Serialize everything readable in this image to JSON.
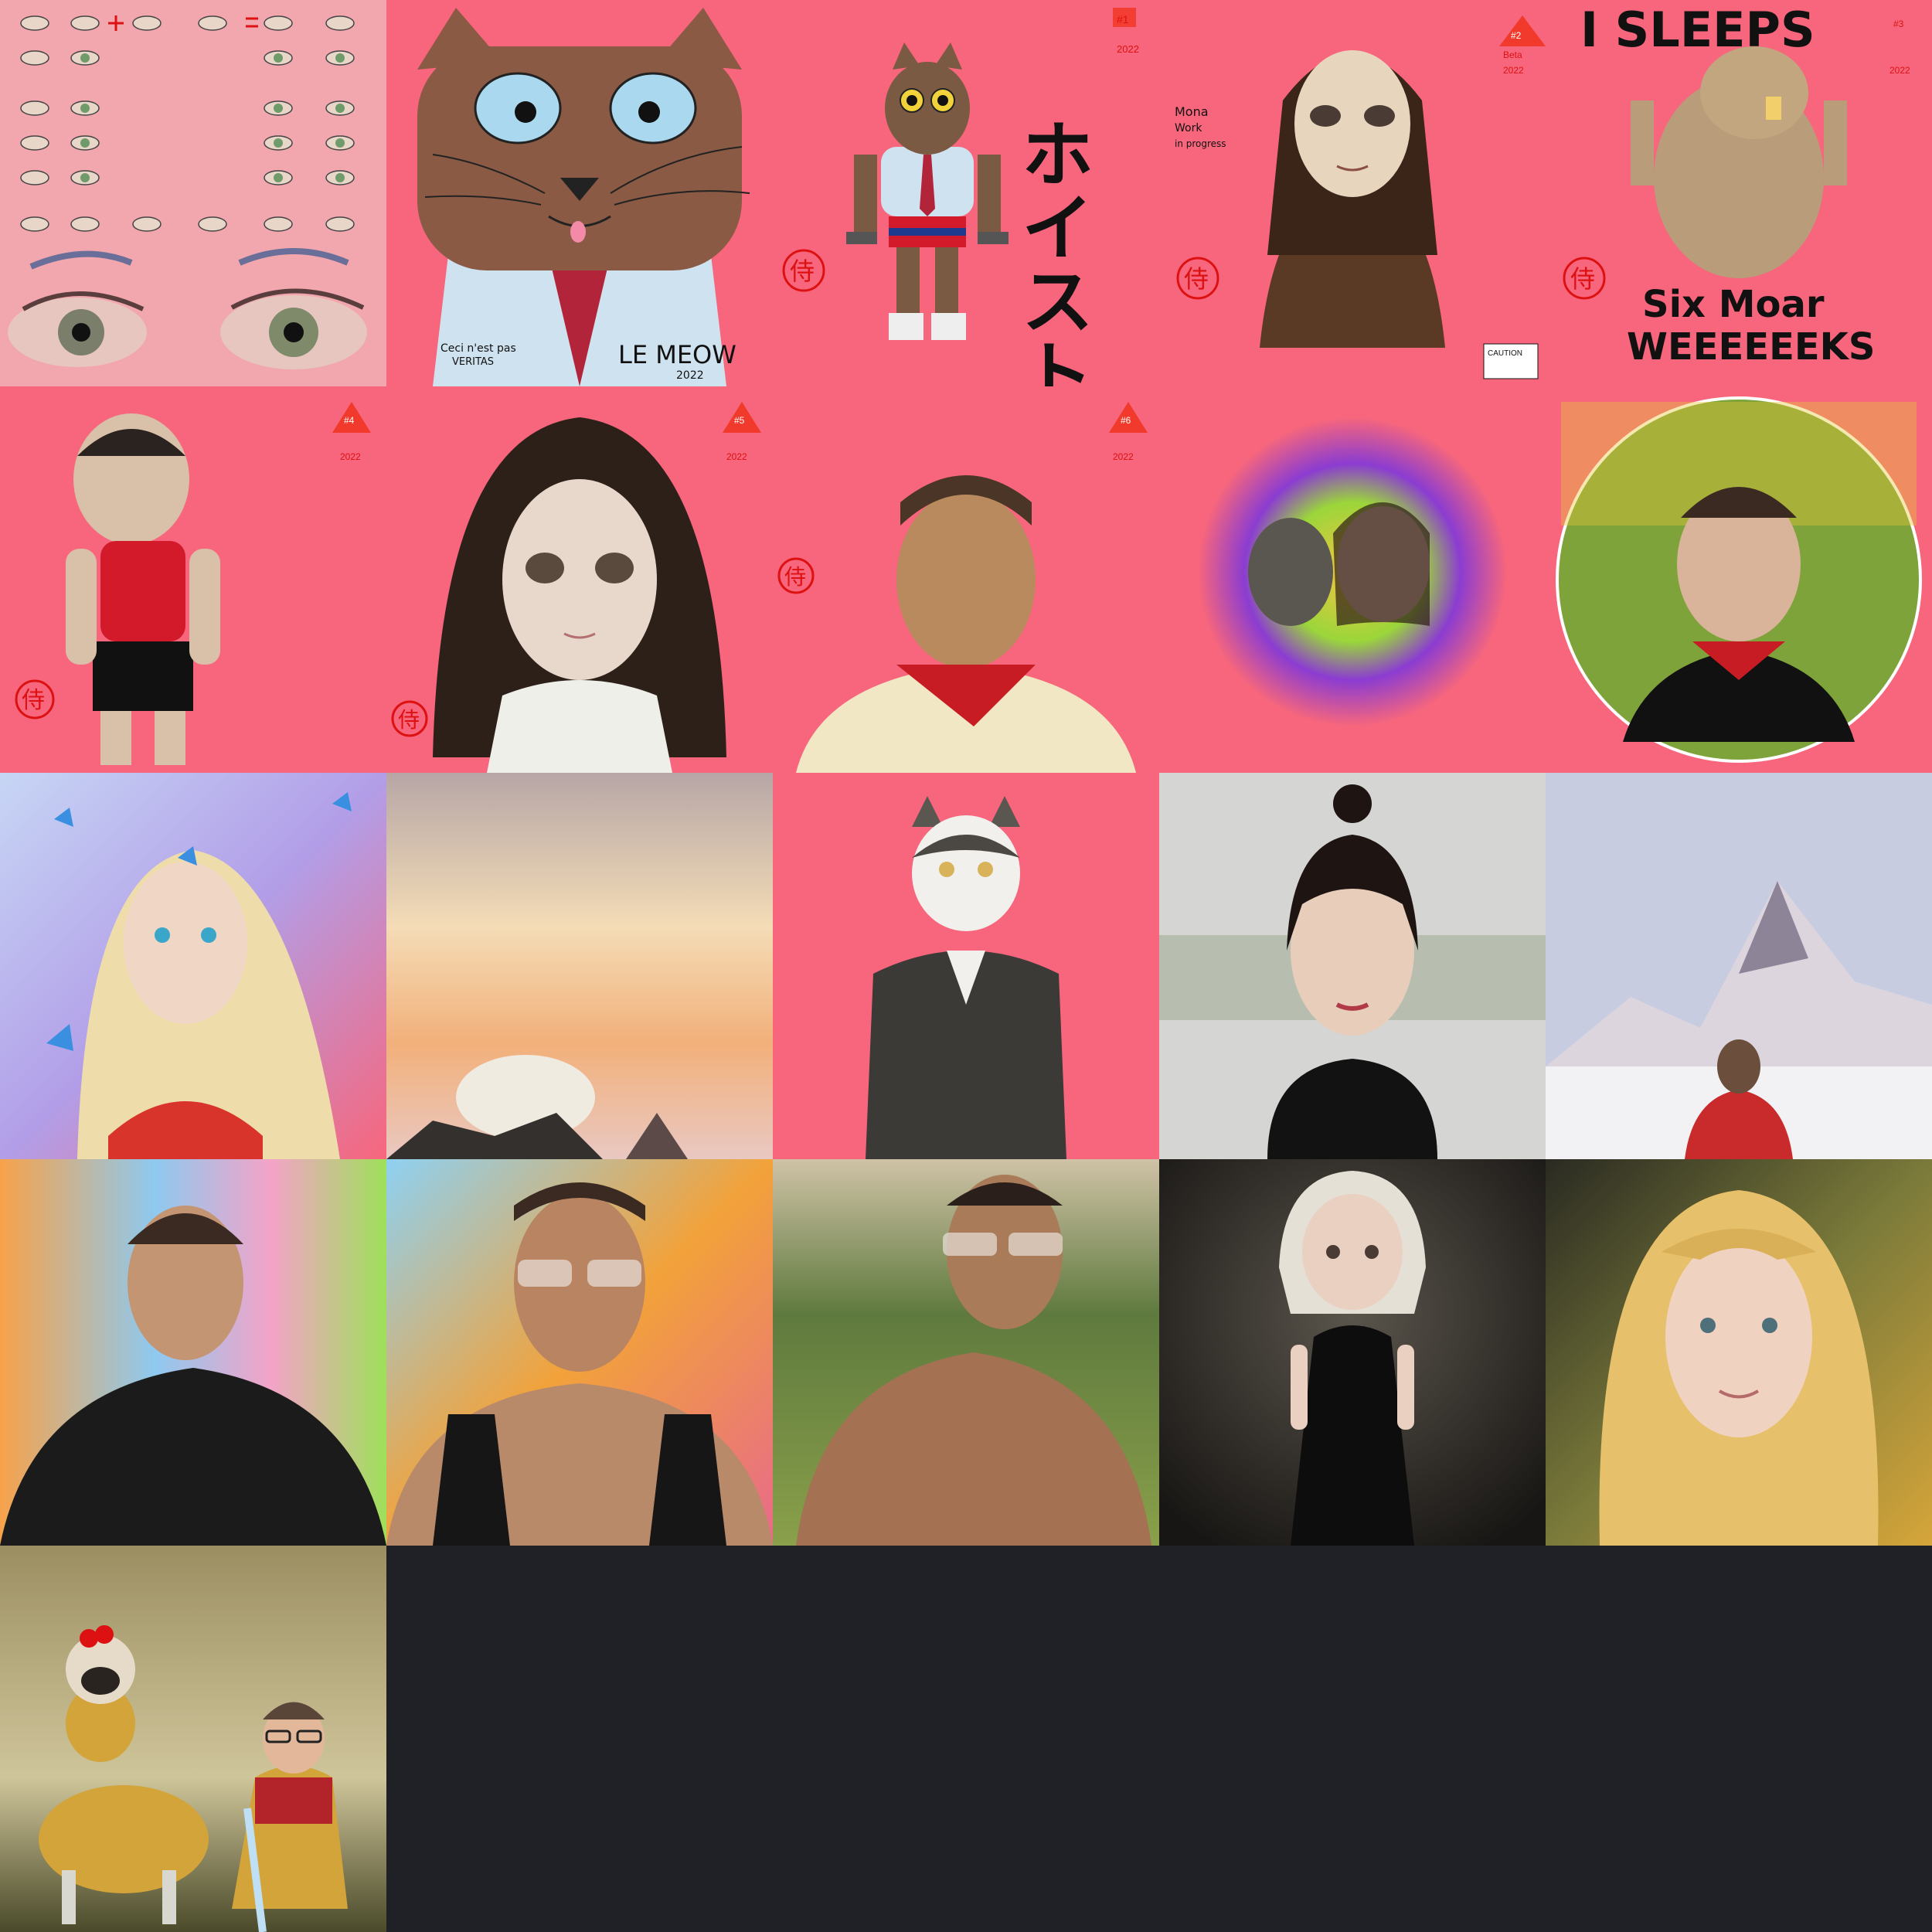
{
  "gallery": {
    "background": "#1f2126",
    "accent": "#f7667c",
    "tiles": [
      {
        "id": "t01",
        "caption": "eye study"
      },
      {
        "id": "t02",
        "caption": "cat in shirt",
        "texts": [
          "Ceci n'est pas",
          "VERITAS",
          "LE MEOW",
          "2022"
        ]
      },
      {
        "id": "t03",
        "caption": "cat lifting",
        "texts": [
          "ホイスト",
          "#1",
          "2022",
          "侍"
        ]
      },
      {
        "id": "t04",
        "caption": "mona lisa",
        "texts": [
          "#2",
          "Beta",
          "2022",
          "Mona",
          "Work",
          "in progress",
          "侍",
          "CAUTION"
        ]
      },
      {
        "id": "t05",
        "caption": "groundhog",
        "texts": [
          "I SLEEPS",
          "#3",
          "2022",
          "Six Moar",
          "WEEEEEEKS",
          "侍"
        ]
      },
      {
        "id": "t06",
        "caption": "big head man",
        "texts": [
          "#4",
          "2022",
          "侍"
        ]
      },
      {
        "id": "t07",
        "caption": "woman portrait",
        "texts": [
          "#5",
          "2022",
          "侍"
        ]
      },
      {
        "id": "t08",
        "caption": "man with bandana",
        "texts": [
          "#6",
          "2022",
          "侍"
        ]
      },
      {
        "id": "t09",
        "caption": "woman with dog in color splash"
      },
      {
        "id": "t10",
        "caption": "man in circle"
      },
      {
        "id": "t11",
        "caption": "elf with butterflies"
      },
      {
        "id": "t12",
        "caption": "hamster at sunset"
      },
      {
        "id": "t13",
        "caption": "cat in uniform"
      },
      {
        "id": "t14",
        "caption": "woman portrait grey"
      },
      {
        "id": "t15",
        "caption": "mountain scene"
      },
      {
        "id": "t16",
        "caption": "man confetti background"
      },
      {
        "id": "t17",
        "caption": "man glasses colorful"
      },
      {
        "id": "t18",
        "caption": "man outdoors"
      },
      {
        "id": "t19",
        "caption": "woman in black dress"
      },
      {
        "id": "t20",
        "caption": "blonde woman"
      },
      {
        "id": "t21",
        "caption": "pug knight and lady"
      }
    ]
  }
}
